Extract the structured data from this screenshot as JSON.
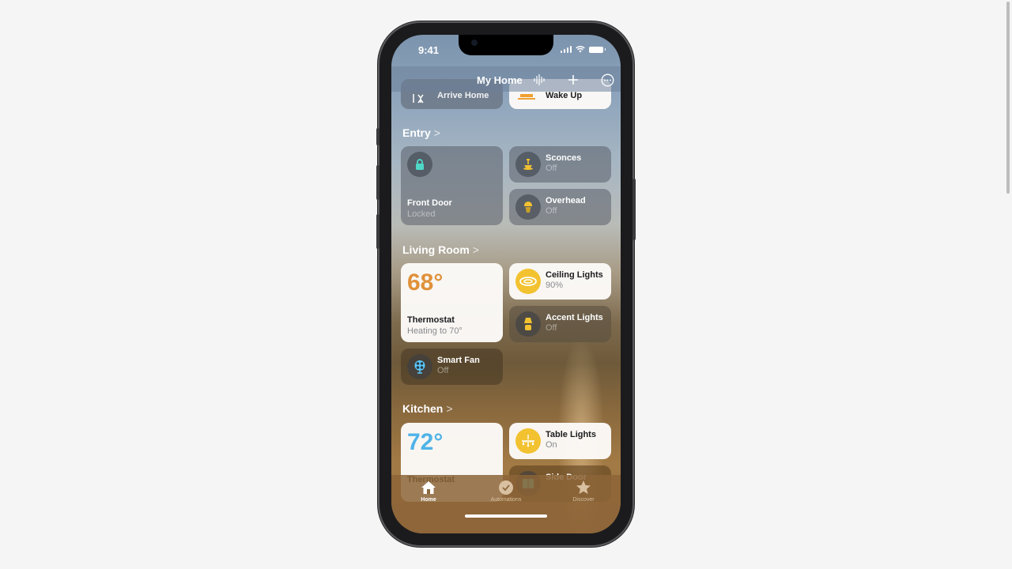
{
  "status_bar": {
    "time": "9:41"
  },
  "nav": {
    "title": "My Home",
    "icons": [
      "siri-waveform-icon",
      "plus-icon",
      "more-icon"
    ]
  },
  "scenes": [
    {
      "label": "Arrive Home",
      "icon": "arrive-home-icon",
      "style": "dark"
    },
    {
      "label": "Wake Up",
      "icon": "wake-up-icon",
      "style": "light"
    }
  ],
  "sections": [
    {
      "title": "Entry",
      "chevron": ">",
      "tiles": [
        {
          "name": "Front Door",
          "state": "Locked",
          "icon": "lock-icon",
          "style": "dark",
          "size": "large"
        },
        {
          "name": "Sconces",
          "state": "Off",
          "icon": "sconce-icon",
          "style": "dark"
        },
        {
          "name": "Overhead",
          "state": "Off",
          "icon": "bulb-icon",
          "style": "dark"
        }
      ]
    },
    {
      "title": "Living Room",
      "chevron": ">",
      "tiles": [
        {
          "name": "Thermostat",
          "state": "Heating to 70°",
          "value": "68°",
          "style": "light",
          "size": "large",
          "value_color": "#e0913a"
        },
        {
          "name": "Ceiling Lights",
          "state": "90%",
          "icon": "ceiling-light-icon",
          "style": "light"
        },
        {
          "name": "Accent Lights",
          "state": "Off",
          "icon": "lamp-icon",
          "style": "dark"
        },
        {
          "name": "Smart Fan",
          "state": "Off",
          "icon": "fan-icon",
          "style": "dark"
        }
      ]
    },
    {
      "title": "Kitchen",
      "chevron": ">",
      "tiles": [
        {
          "name": "Thermostat",
          "value": "72°",
          "style": "light",
          "size": "large",
          "value_color": "#4fb3e8"
        },
        {
          "name": "Table Lights",
          "state": "On",
          "icon": "chandelier-icon",
          "style": "light"
        },
        {
          "name": "Side Door",
          "icon": "door-icon",
          "style": "dark"
        }
      ]
    }
  ],
  "tab_bar": {
    "tabs": [
      {
        "label": "Home",
        "icon": "house-icon",
        "active": true
      },
      {
        "label": "Automations",
        "icon": "clock-check-icon",
        "active": false
      },
      {
        "label": "Discover",
        "icon": "star-icon",
        "active": false
      }
    ]
  },
  "colors": {
    "accent_yellow": "#f2c230",
    "lock_teal": "#4fd8c8",
    "fan_blue": "#5ac8fa"
  }
}
